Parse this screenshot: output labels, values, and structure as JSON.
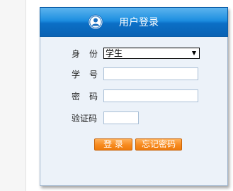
{
  "header": {
    "title": "用户登录",
    "icon": "user-circle-icon"
  },
  "form": {
    "identity": {
      "label": "身份",
      "value": "学生"
    },
    "student_id": {
      "label": "学号",
      "value": ""
    },
    "password": {
      "label": "密码",
      "value": ""
    },
    "captcha": {
      "label": "验证码",
      "value": ""
    }
  },
  "buttons": {
    "login": "登 录",
    "forgot_password": "忘记密码"
  },
  "colors": {
    "header_top": "#5cb4ee",
    "header_bottom": "#0a62b4",
    "panel_bg": "#ecf2f9",
    "button_orange": "#f78a1e"
  }
}
